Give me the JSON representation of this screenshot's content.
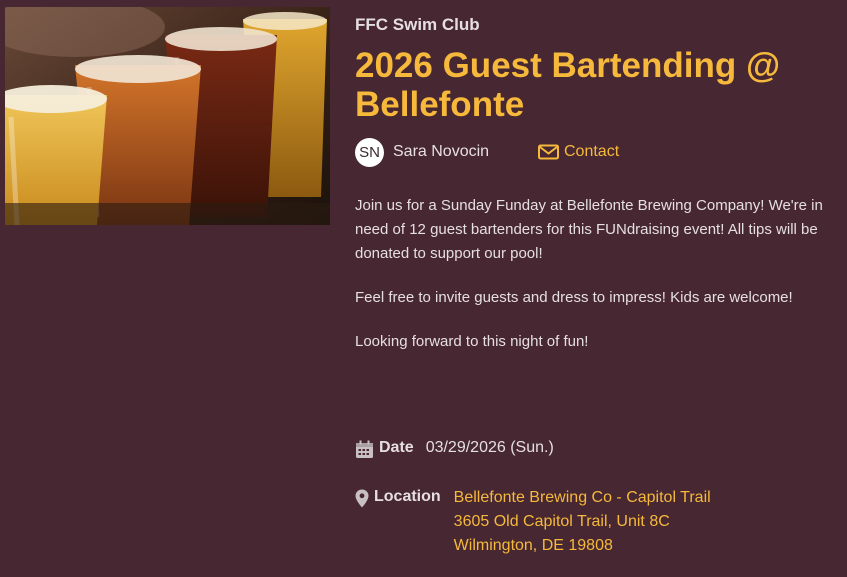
{
  "event": {
    "organization": "FFC Swim Club",
    "title": "2026 Guest Bartending @ Bellefonte",
    "organizer": {
      "initials": "SN",
      "name": "Sara Novocin"
    },
    "contact_label": "Contact",
    "description": [
      "Join us for a Sunday Funday at Bellefonte Brewing Company! We're in need of 12 guest bartenders for this FUNdraising event! All tips will be donated to support our pool!",
      "Feel free to invite guests and dress to impress! Kids are welcome!",
      "Looking forward to this night of fun!"
    ],
    "date_label": "Date",
    "date_value": "03/29/2026 (Sun.)",
    "location_label": "Location",
    "location_lines": [
      "Bellefonte Brewing Co - Capitol Trail",
      "3605 Old Capitol Trail, Unit 8C",
      "Wilmington, DE 19808"
    ]
  },
  "icons": {
    "hero": "beer-flight-photo",
    "contact": "envelope-icon",
    "date": "calendar-icon",
    "location": "map-pin-icon"
  },
  "colors": {
    "background": "#462732",
    "accent": "#f6b93b",
    "text": "#e6dfe1"
  }
}
